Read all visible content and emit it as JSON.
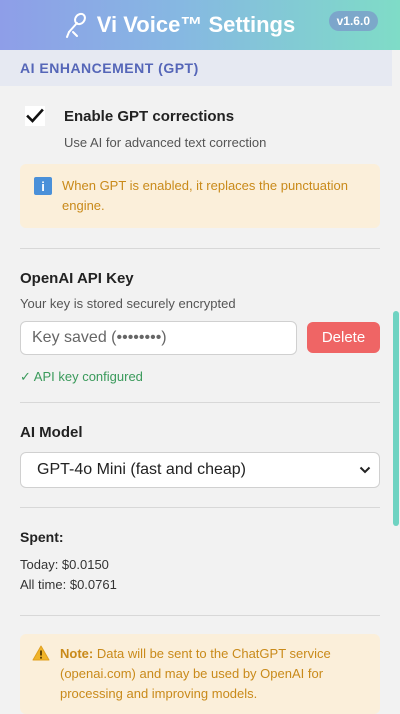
{
  "header": {
    "title": "Vi Voice™ Settings",
    "version": "v1.6.0",
    "icon": "mic-icon"
  },
  "section": {
    "title": "AI ENHANCEMENT (GPT)"
  },
  "gpt": {
    "enabled": true,
    "label": "Enable GPT corrections",
    "description": "Use AI for advanced text correction",
    "info": "When GPT is enabled, it replaces the punctuation engine."
  },
  "api_key": {
    "title": "OpenAI API Key",
    "description": "Your key is stored securely encrypted",
    "placeholder": "Key saved (••••••••)",
    "value": "",
    "delete_label": "Delete",
    "status": "✓ API key configured"
  },
  "model": {
    "title": "AI Model",
    "selected": "GPT-4o Mini (fast and cheap)"
  },
  "spent": {
    "title": "Spent:",
    "today": "Today: $0.0150",
    "all_time": "All time: $0.0761"
  },
  "note": {
    "label": "Note:",
    "text": " Data will be sent to the ChatGPT service (openai.com) and may be used by OpenAI for processing and improving models."
  },
  "colors": {
    "accent": "#5566b8",
    "danger": "#ef6565",
    "success": "#3a9a5b",
    "warning_text": "#c98a1a",
    "warning_bg": "#fbefda",
    "scrollbar": "#6fd3c2"
  }
}
